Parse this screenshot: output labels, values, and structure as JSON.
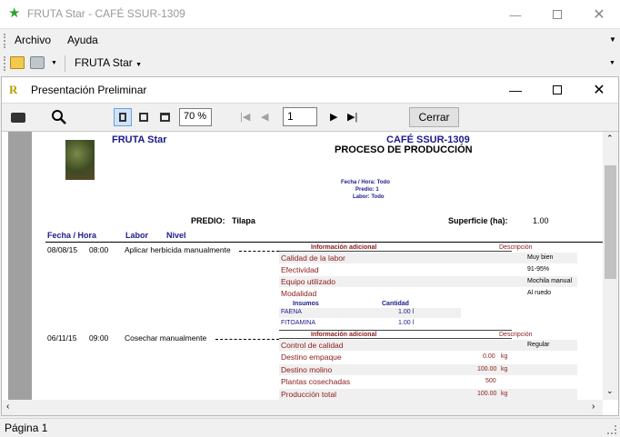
{
  "app": {
    "title": "FRUTA Star - CAFÉ SSUR-1309"
  },
  "menu": {
    "archivo": "Archivo",
    "ayuda": "Ayuda"
  },
  "toolbar": {
    "fruta_label": "FRUTA Star"
  },
  "preview": {
    "title": "Presentación Preliminar",
    "zoom": "70 %",
    "page": "1",
    "close_label": "Cerrar"
  },
  "report": {
    "company": "FRUTA Star",
    "farm": "CAFÉ SSUR-1309",
    "heading": "PROCESO DE PRODUCCIÓN",
    "filters": [
      "Fecha / Hora: Todo",
      "Predio: 1",
      "Labor: Todo"
    ],
    "predio_label": "PREDIO:",
    "predio_value": "Tilapa",
    "superficie_label": "Superficie (ha):",
    "superficie_value": "1.00",
    "cols": {
      "fecha": "Fecha / Hora",
      "labor": "Labor",
      "nivel": "Nivel"
    },
    "info_header": "Información adicional",
    "desc_header": "Descripción",
    "insumos_header": "Insumos",
    "cantidad_header": "Cantidad",
    "entries": [
      {
        "date": "08/08/15",
        "time": "08:00",
        "labor": "Aplicar herbicida manualmente",
        "info": [
          {
            "label": "Calidad de la labor",
            "desc": "Muy bien"
          },
          {
            "label": "Efectividad",
            "desc": "91-95%"
          },
          {
            "label": "Equipo utilizado",
            "desc": "Mochila manual"
          },
          {
            "label": "Modalidad",
            "desc": "Al ruedo"
          }
        ],
        "insumos": [
          {
            "name": "FAENA",
            "qty": "1.00 l"
          },
          {
            "name": "FITOAMINA",
            "qty": "1.00 l"
          }
        ]
      },
      {
        "date": "06/11/15",
        "time": "09:00",
        "labor": "Cosechar manualmente",
        "info": [
          {
            "label": "Control de calidad",
            "val": "",
            "unit": "",
            "desc": "Regular"
          },
          {
            "label": "Destino empaque",
            "val": "0.00",
            "unit": "kg",
            "desc": ""
          },
          {
            "label": "Destino molino",
            "val": "100.00",
            "unit": "kg",
            "desc": ""
          },
          {
            "label": "Plantas cosechadas",
            "val": "500",
            "unit": "",
            "desc": ""
          },
          {
            "label": "Producción total",
            "val": "100.00",
            "unit": "kg",
            "desc": ""
          }
        ]
      }
    ]
  },
  "status": {
    "page": "Página 1"
  }
}
